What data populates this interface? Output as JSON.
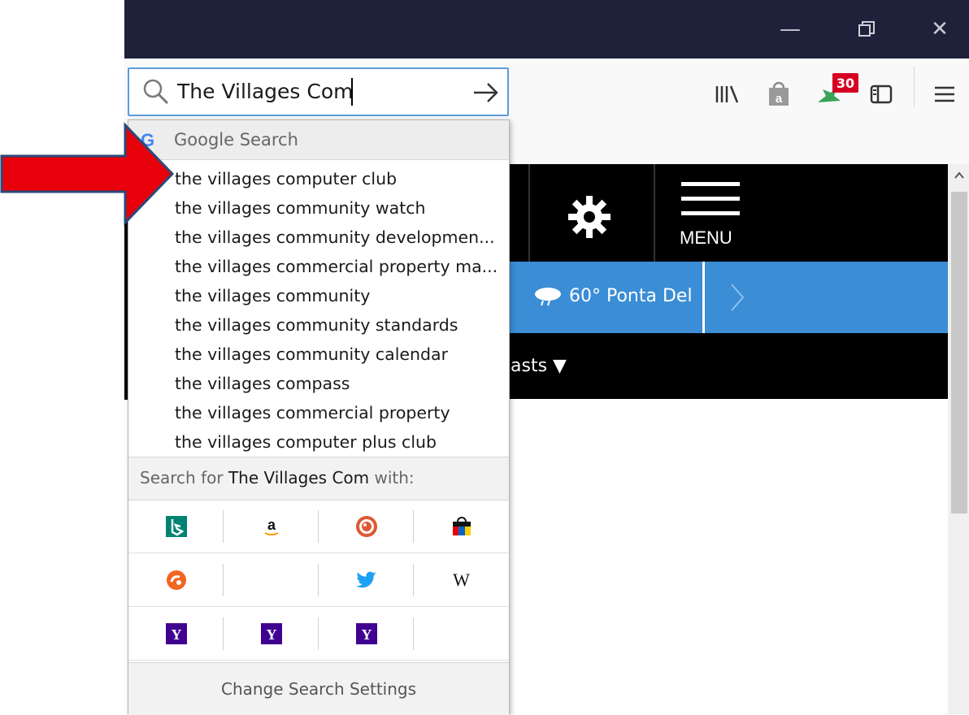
{
  "window": {
    "minimize_glyph": "—",
    "restore_glyph": "❐",
    "close_glyph": "✕"
  },
  "urlbar": {
    "value": "The Villages Com",
    "search_icon": "search-icon",
    "go_icon": "arrow-right-icon"
  },
  "toolbar": {
    "icons": [
      "library-icon",
      "shopping-bag-icon",
      "extension-icon",
      "sidebar-icon",
      "hamburger-menu-icon"
    ],
    "badge_count": "30"
  },
  "page": {
    "menu_label": "MENU",
    "weather": "60° Ponta Del",
    "casts": "asts ▼"
  },
  "dropdown": {
    "header": "Google Search",
    "suggestions": [
      "the villages computer club",
      "the villages community watch",
      "the villages community developmen...",
      "the villages commercial property ma...",
      "the villages community",
      "the villages community standards",
      "the villages community calendar",
      "the villages compass",
      "the villages commercial property",
      "the villages computer plus club"
    ],
    "search_for_prefix": "Search for ",
    "search_for_query": "The Villages Com",
    "search_for_suffix": " with:",
    "engines": [
      "bing-icon",
      "amazon-icon",
      "duckduckgo-icon",
      "shopping-icon",
      "startpage-icon",
      "empty-slot",
      "twitter-icon",
      "wikipedia-icon",
      "yahoo-icon",
      "yahoo-icon",
      "yahoo-icon",
      "empty-slot"
    ],
    "wikipedia_glyph": "W",
    "yahoo_glyph": "Y",
    "amazon_glyph": "a",
    "change_settings": "Change Search Settings"
  },
  "annotation": {
    "arrow_color": "#e8000b"
  }
}
